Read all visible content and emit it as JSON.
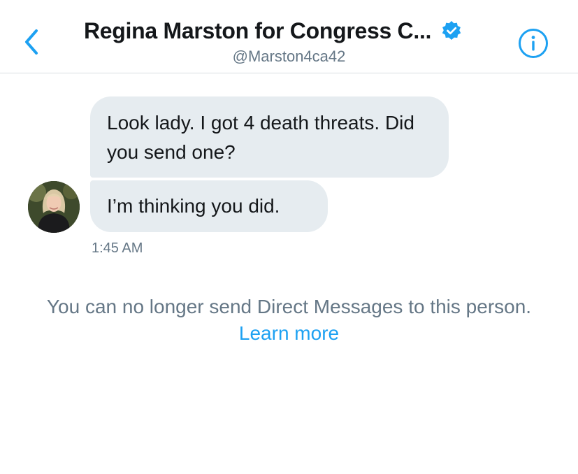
{
  "header": {
    "title": "Regina Marston for Congress C...",
    "handle": "@Marston4ca42",
    "verified_icon": "verified-badge-icon",
    "back_icon": "chevron-left-icon",
    "info_icon": "info-circle-icon"
  },
  "conversation": {
    "messages": [
      {
        "text": "Look lady. I got 4 death threats. Did you send one?"
      },
      {
        "text": "I’m thinking you did."
      }
    ],
    "timestamp": "1:45 AM"
  },
  "notice": {
    "text": "You can no longer send Direct Messages to this person.",
    "link_label": "Learn more"
  },
  "colors": {
    "accent": "#1da1f2",
    "bubble": "#e6ecf0",
    "secondary_text": "#657786"
  }
}
